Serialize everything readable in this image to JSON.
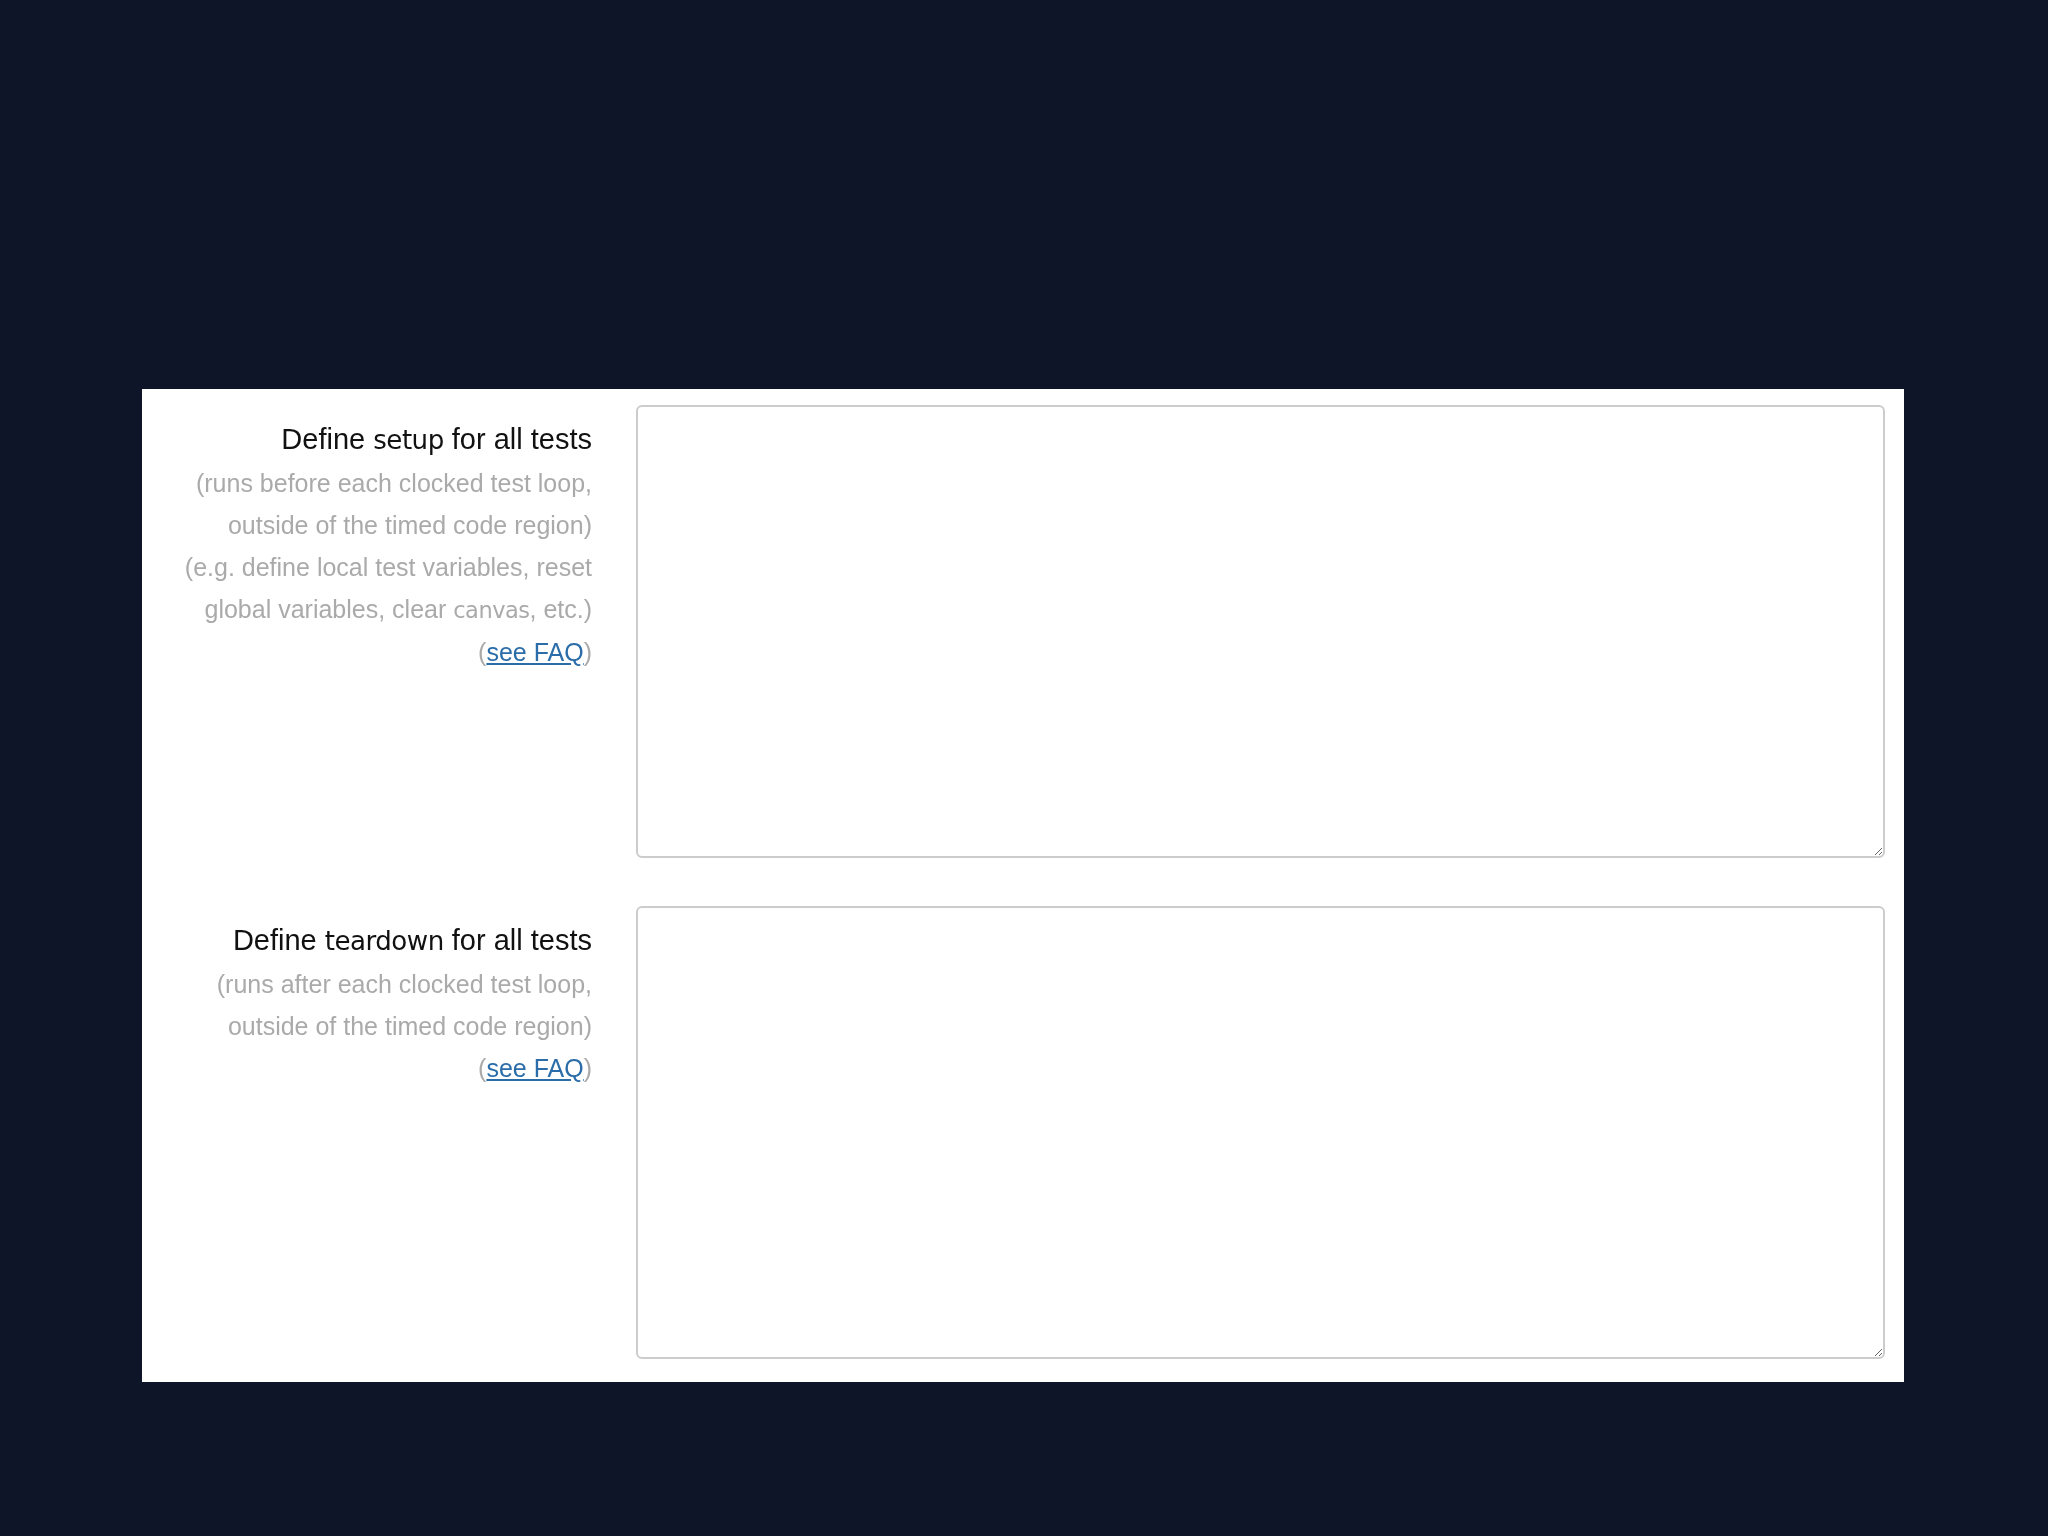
{
  "sections": [
    {
      "title": [
        {
          "kind": "plain",
          "text": "Define "
        },
        {
          "kind": "code",
          "text": "setup"
        },
        {
          "kind": "plain",
          "text": " for all tests"
        }
      ],
      "notes": [
        [
          {
            "kind": "plain",
            "text": "(runs before each clocked test loop, outside of the timed code region)"
          }
        ],
        [
          {
            "kind": "plain",
            "text": "(e.g. define local test variables, reset global variables, clear "
          },
          {
            "kind": "code",
            "text": "canvas"
          },
          {
            "kind": "plain",
            "text": ", etc.)"
          }
        ]
      ],
      "faq": {
        "open": "(",
        "link": "see FAQ",
        "close": ")"
      }
    },
    {
      "title": [
        {
          "kind": "plain",
          "text": "Define "
        },
        {
          "kind": "code",
          "text": "teardown"
        },
        {
          "kind": "plain",
          "text": " for all tests"
        }
      ],
      "notes": [
        [
          {
            "kind": "plain",
            "text": "(runs after each clocked test loop, outside of the timed code region)"
          }
        ]
      ],
      "faq": {
        "open": "(",
        "link": "see FAQ",
        "close": ")"
      }
    }
  ]
}
